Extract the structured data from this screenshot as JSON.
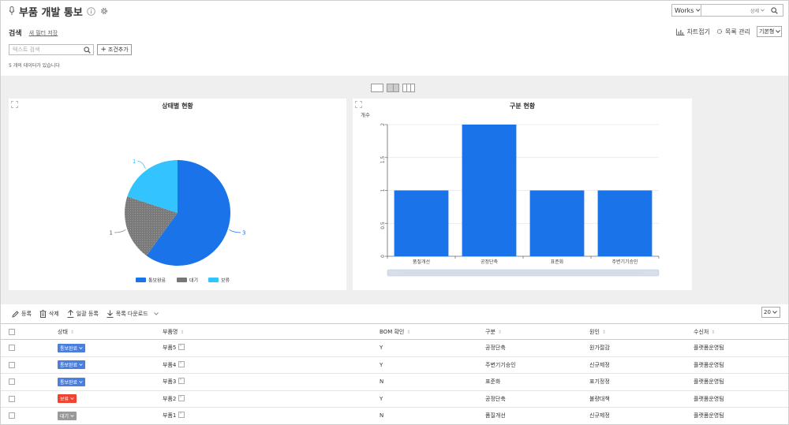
{
  "header": {
    "title": "부품 개발 통보",
    "app_select": "Works",
    "top_search_detail": "상세",
    "search_label": "검색",
    "save_filter": "새 필터 저장",
    "chart_fold": "차트접기",
    "list_manage": "목록 관리",
    "view_type": "기본형",
    "search_placeholder": "텍스트 검색",
    "add_condition": "조건추가",
    "count_text": "5 개의 데이터가 있습니다"
  },
  "colors": {
    "blue": "#1a73e8",
    "gray": "#777777",
    "lightblue": "#33c3ff",
    "red": "#ee4433",
    "badge_blue": "#4a7fe0",
    "badge_gray": "#999999"
  },
  "chart_data": [
    {
      "type": "pie",
      "title": "상태별 현황",
      "slices": [
        {
          "name": "통보완료",
          "value": 3,
          "color": "#1a73e8"
        },
        {
          "name": "대기",
          "value": 1,
          "color": "#777777"
        },
        {
          "name": "보류",
          "value": 1,
          "color": "#33c3ff"
        }
      ],
      "legend": "bottom"
    },
    {
      "type": "bar",
      "title": "구분 현황",
      "ylabel": "개수",
      "categories": [
        "품질개선",
        "공정단축",
        "표준화",
        "주변기기승인"
      ],
      "values": [
        1,
        2,
        1,
        1
      ],
      "ylim": [
        0,
        2
      ],
      "yticks": [
        "0",
        "0.5",
        "1",
        "1.5",
        "2"
      ],
      "color": "#1a73e8",
      "grid": true
    }
  ],
  "toolbar": {
    "register": "등록",
    "delete": "삭제",
    "bulk_register": "일괄 등록",
    "list_download": "목록 다운로드",
    "page_size": "20"
  },
  "table": {
    "columns": [
      "상태",
      "부품명",
      "BOM 확인",
      "구분",
      "원인",
      "수신처"
    ],
    "rows": [
      {
        "status": "통보완료",
        "status_color": "#4a7fe0",
        "name": "부품5",
        "bom": "Y",
        "category": "공정단축",
        "cause": "원가절감",
        "receiver": "플랫폼운영팀"
      },
      {
        "status": "통보완료",
        "status_color": "#4a7fe0",
        "name": "부품4",
        "bom": "Y",
        "category": "주변기기승인",
        "cause": "신규제정",
        "receiver": "플랫폼운영팀"
      },
      {
        "status": "통보완료",
        "status_color": "#4a7fe0",
        "name": "부품3",
        "bom": "N",
        "category": "표준화",
        "cause": "표기정정",
        "receiver": "플랫폼운영팀"
      },
      {
        "status": "보류",
        "status_color": "#ee4433",
        "name": "부품2",
        "bom": "Y",
        "category": "공정단축",
        "cause": "불량대책",
        "receiver": "플랫폼운영팀"
      },
      {
        "status": "대기",
        "status_color": "#999999",
        "name": "부품1",
        "bom": "N",
        "category": "품질개선",
        "cause": "신규제정",
        "receiver": "플랫폼운영팀"
      }
    ]
  }
}
